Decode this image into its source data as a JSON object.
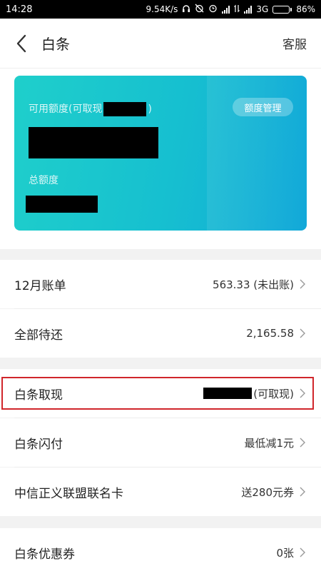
{
  "status_bar": {
    "time": "14:28",
    "net_speed": "9.54K/s",
    "network": "3G",
    "battery": "86%",
    "battery_level": 0.86
  },
  "nav": {
    "title": "白条",
    "service": "客服",
    "back_icon": "chevron-left-icon"
  },
  "card": {
    "available_label_prefix": "可用额度(可取现",
    "available_label_suffix": ")",
    "total_label": "总额度",
    "manage_button": "额度管理"
  },
  "rows": {
    "bill": {
      "label": "12月账单",
      "value": "563.33 (未出账)"
    },
    "pending": {
      "label": "全部待还",
      "value": "2,165.58"
    },
    "cash": {
      "label": "白条取现",
      "value": "(可取现)"
    },
    "flash": {
      "label": "白条闪付",
      "value": "最低减1元"
    },
    "citic": {
      "label": "中信正义联盟联名卡",
      "value": "送280元券"
    },
    "coupon": {
      "label": "白条优惠券",
      "value": "0张"
    }
  },
  "colors": {
    "card_start": "#1fcfcb",
    "card_end": "#12a8d9",
    "highlight": "#d0262b"
  }
}
